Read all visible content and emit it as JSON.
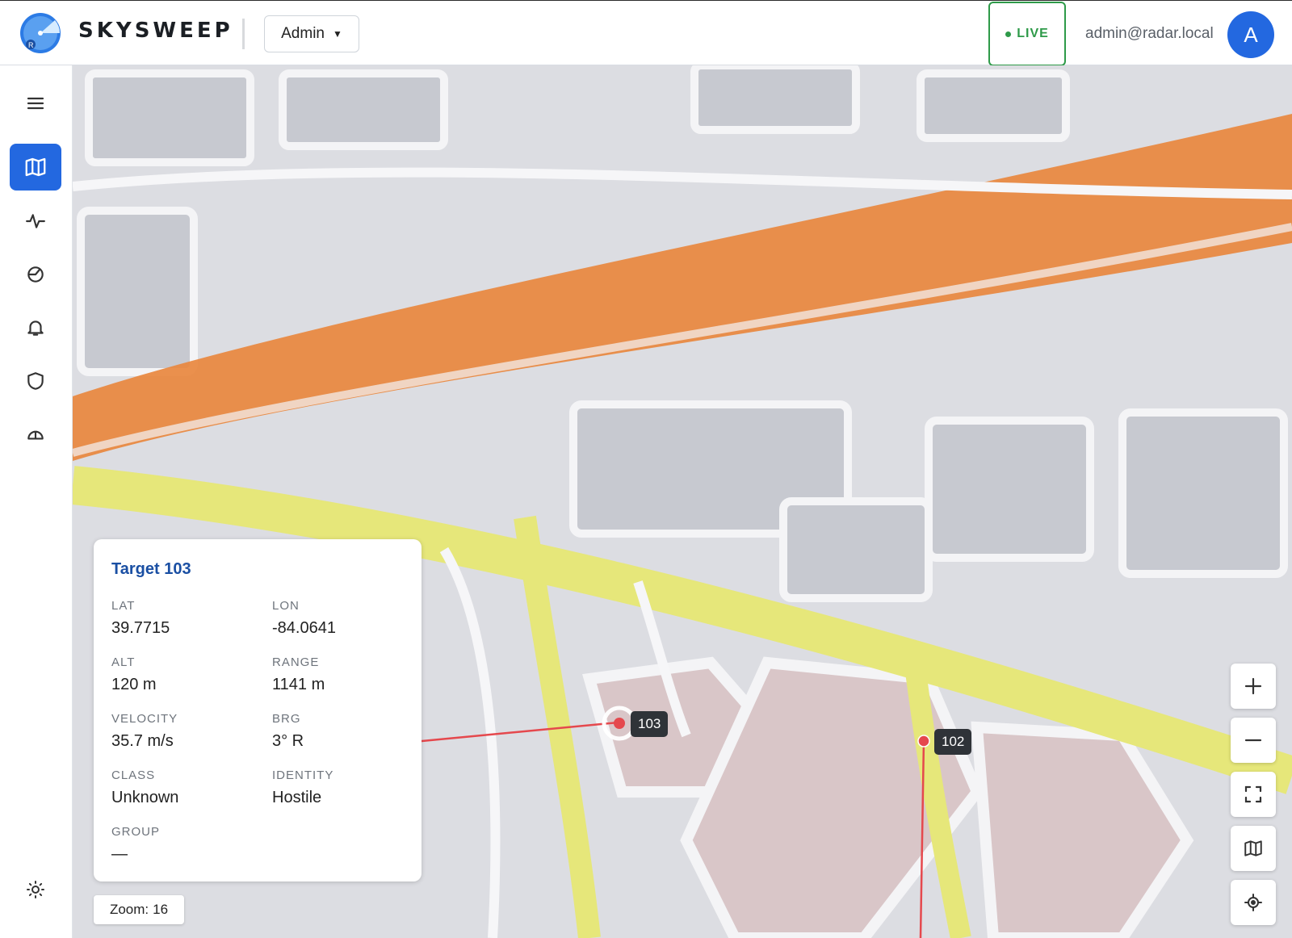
{
  "header": {
    "brand": "SKYSWEEP",
    "role_selector": "Admin",
    "live_label": "LIVE",
    "user_email": "admin@radar.local",
    "avatar_initial": "A"
  },
  "sidebar": {
    "items": [
      {
        "icon": "menu-icon"
      },
      {
        "icon": "map-icon",
        "active": true
      },
      {
        "icon": "activity-icon"
      },
      {
        "icon": "radar-icon"
      },
      {
        "icon": "bell-icon"
      },
      {
        "icon": "shield-icon"
      },
      {
        "icon": "dome-icon"
      },
      {
        "icon": "settings-sun-icon"
      }
    ]
  },
  "target_card": {
    "title": "Target 103",
    "lat_label": "LAT",
    "lat": "39.7715",
    "lon_label": "LON",
    "lon": "-84.0641",
    "alt_label": "ALT",
    "alt": "120 m",
    "range_label": "RANGE",
    "range": "1141 m",
    "velocity_label": "VELOCITY",
    "velocity": "35.7 m/s",
    "brg_label": "BRG",
    "brg": "3° R",
    "class_label": "CLASS",
    "class": "Unknown",
    "identity_label": "IDENTITY",
    "identity": "Hostile",
    "group_label": "GROUP",
    "group": "—"
  },
  "map": {
    "zoom_label": "Zoom:",
    "zoom_value": "16",
    "targets": [
      {
        "id": "103",
        "selected": true
      },
      {
        "id": "102",
        "selected": false
      }
    ],
    "controls": [
      "zoom-in-icon",
      "zoom-out-icon",
      "fullscreen-icon",
      "layers-map-icon",
      "locate-icon"
    ]
  },
  "colors": {
    "accent": "#2368e0",
    "live": "#2e9a49",
    "target": "#e5484d",
    "road_major": "#e8873e",
    "road_secondary": "#e6e77a"
  }
}
